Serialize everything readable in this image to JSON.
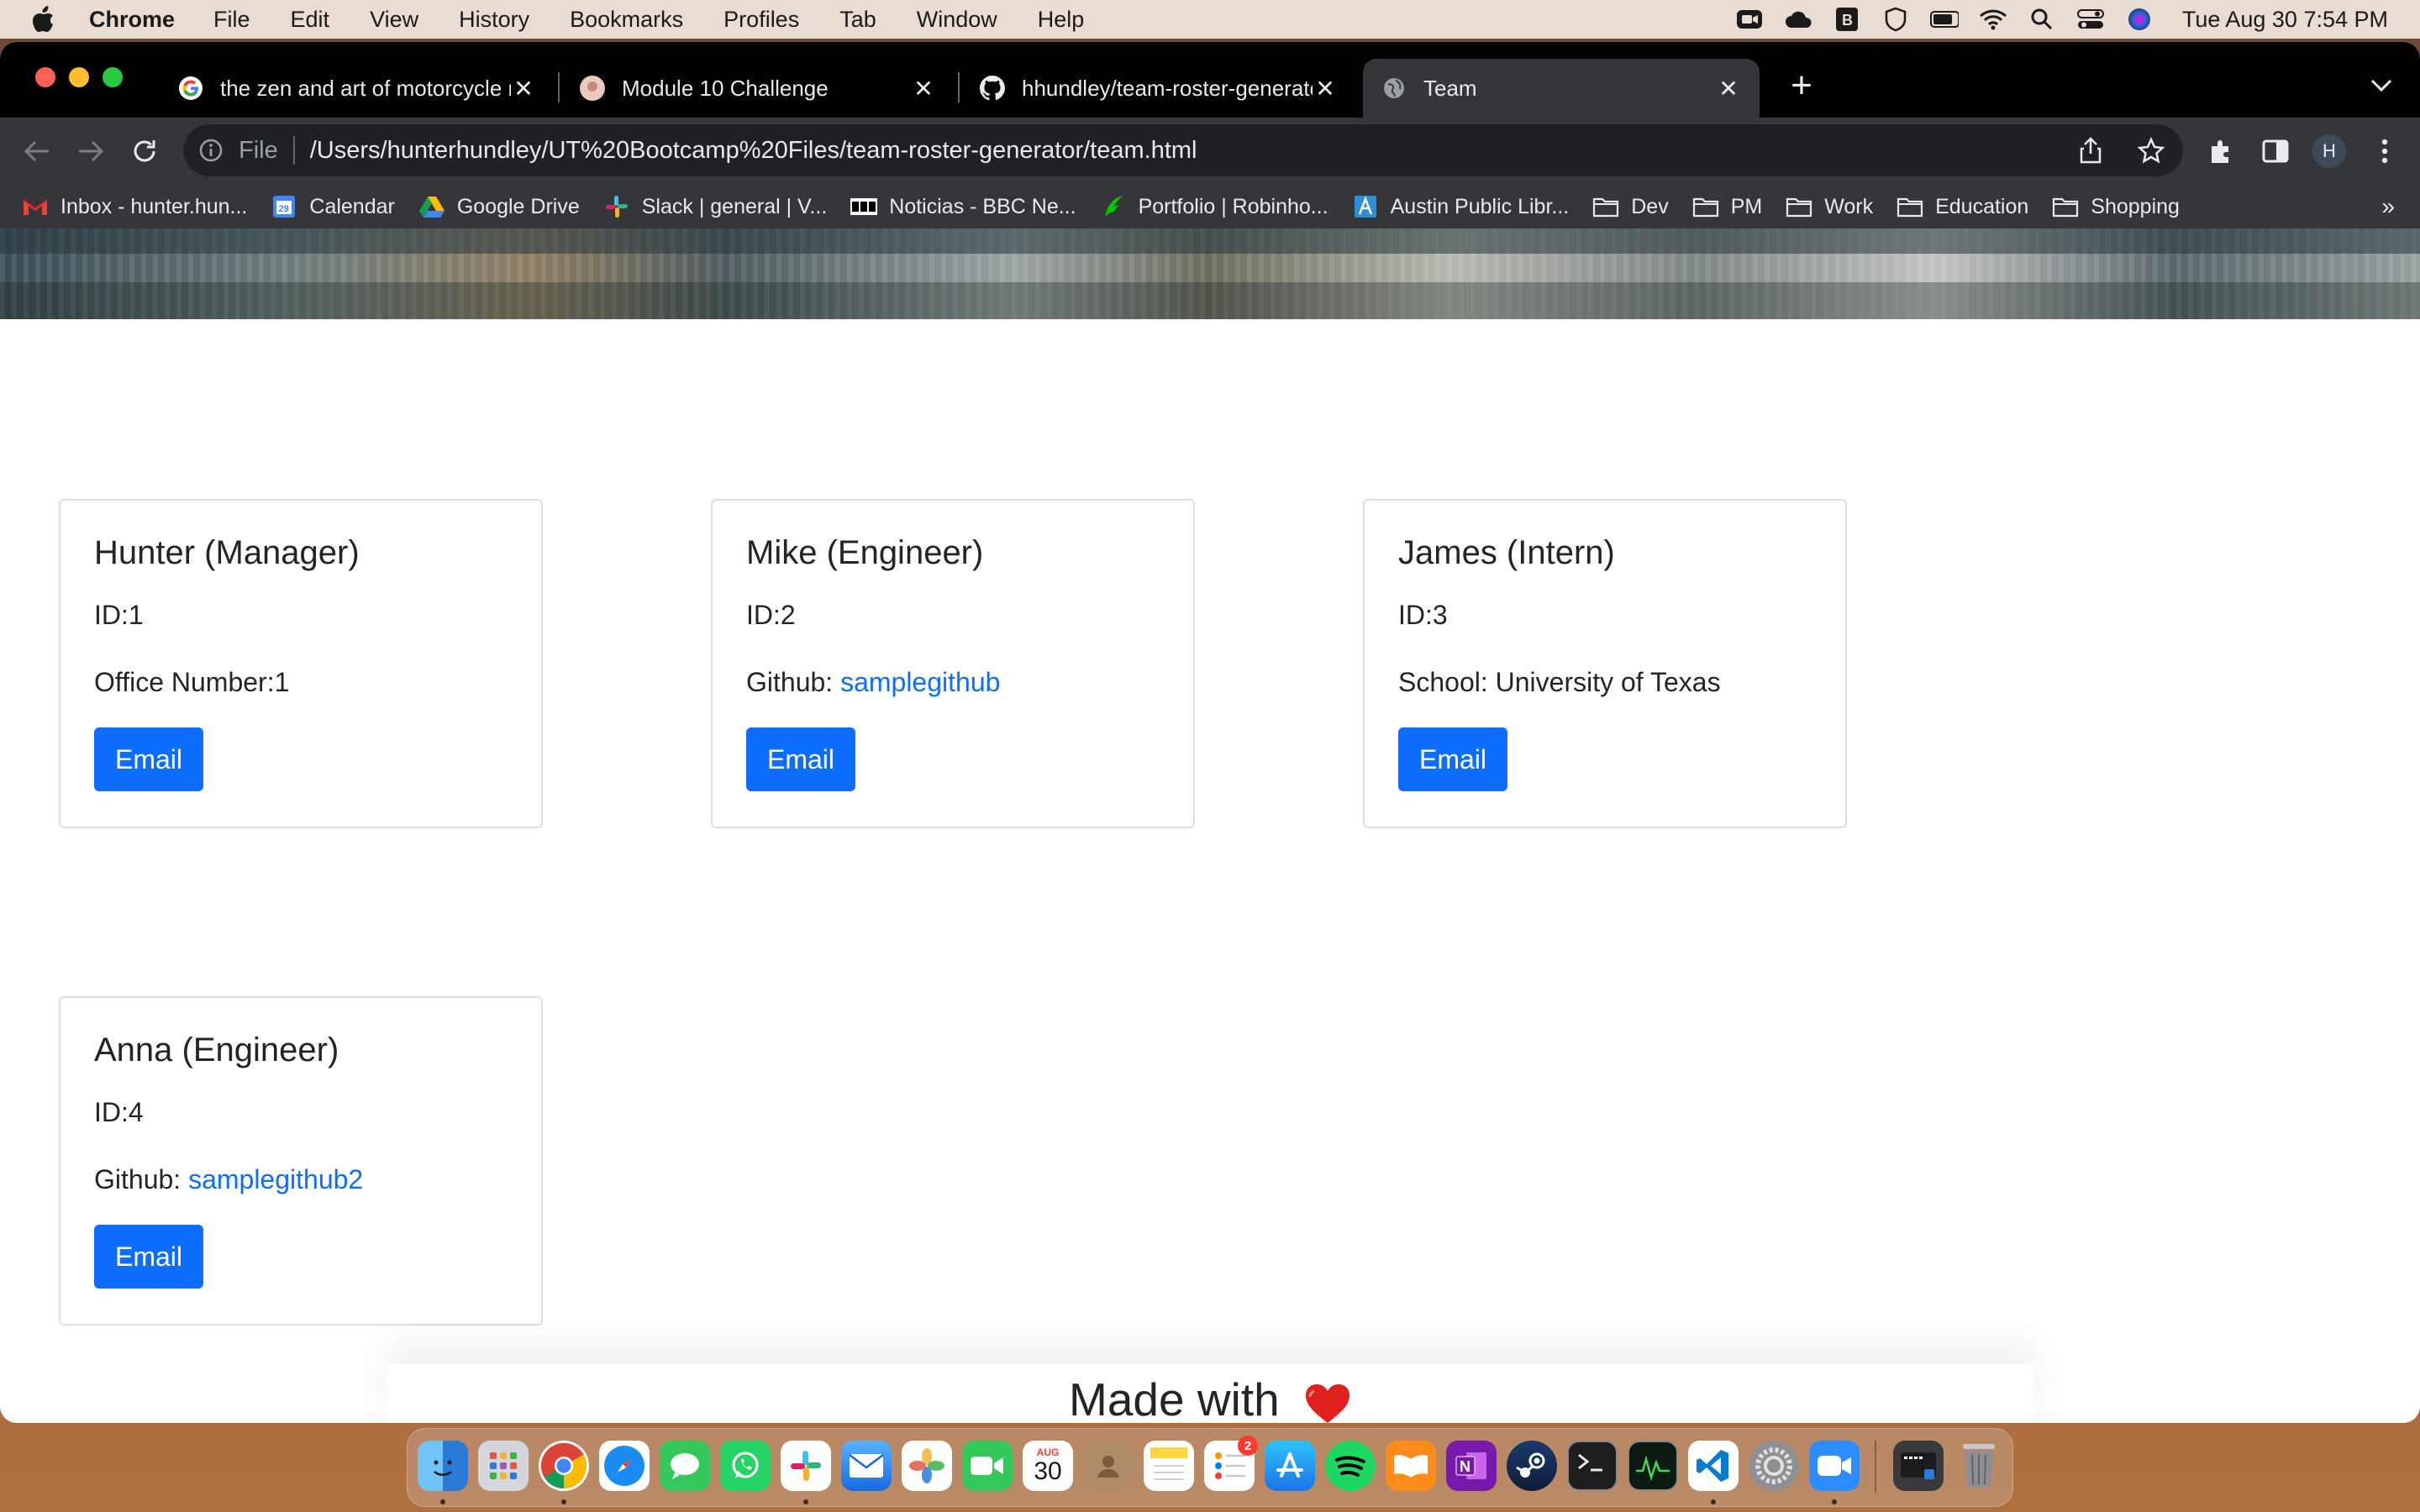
{
  "menubar": {
    "app_name": "Chrome",
    "items": [
      "File",
      "Edit",
      "View",
      "History",
      "Bookmarks",
      "Profiles",
      "Tab",
      "Window",
      "Help"
    ],
    "status_icons": [
      "zoom-icon",
      "cloud-icon",
      "bitwarden-icon",
      "vpn-shield-icon",
      "battery-icon",
      "wifi-icon",
      "spotlight-search-icon",
      "control-center-icon",
      "siri-icon"
    ],
    "clock": "Tue Aug 30  7:54 PM"
  },
  "tabs": [
    {
      "title": "the zen and art of motorcycle m",
      "icon": "google-icon",
      "active": false
    },
    {
      "title": "Module 10 Challenge",
      "icon": "site-favicon-icon",
      "active": false
    },
    {
      "title": "hhundley/team-roster-generato",
      "icon": "github-icon",
      "active": false
    },
    {
      "title": "Team",
      "icon": "globe-icon",
      "active": true
    }
  ],
  "omnibox": {
    "scheme": "File",
    "url": "/Users/hunterhundley/UT%20Bootcamp%20Files/team-roster-generator/team.html"
  },
  "profile": {
    "initial": "H"
  },
  "bookmarks": [
    {
      "label": "Inbox - hunter.hun...",
      "icon": "gmail-icon"
    },
    {
      "label": "Calendar",
      "icon": "calendar-icon"
    },
    {
      "label": "Google Drive",
      "icon": "google-drive-icon"
    },
    {
      "label": "Slack | general | V...",
      "icon": "slack-icon"
    },
    {
      "label": "Noticias - BBC Ne...",
      "icon": "bbc-icon"
    },
    {
      "label": "Portfolio | Robinho...",
      "icon": "robinhood-feather-icon"
    },
    {
      "label": "Austin Public Libr...",
      "icon": "library-icon"
    },
    {
      "label": "Dev",
      "icon": "folder-icon"
    },
    {
      "label": "PM",
      "icon": "folder-icon"
    },
    {
      "label": "Work",
      "icon": "folder-icon"
    },
    {
      "label": "Education",
      "icon": "folder-icon"
    },
    {
      "label": "Shopping",
      "icon": "folder-icon"
    }
  ],
  "bookmarks_more": "»",
  "cards": [
    {
      "title": "Hunter (Manager)",
      "id_text": "ID:1",
      "detail_label": "Office Number:1",
      "detail_link": "",
      "button": "Email"
    },
    {
      "title": "Mike (Engineer)",
      "id_text": "ID:2",
      "detail_label": "Github: ",
      "detail_link": "samplegithub",
      "button": "Email"
    },
    {
      "title": "James (Intern)",
      "id_text": "ID:3",
      "detail_label": "School: University of Texas",
      "detail_link": "",
      "button": "Email"
    },
    {
      "title": "Anna (Engineer)",
      "id_text": "ID:4",
      "detail_label": "Github: ",
      "detail_link": "samplegithub2",
      "button": "Email"
    }
  ],
  "footer": {
    "text": "Made with"
  },
  "dock": {
    "apps": [
      "finder-icon",
      "launchpad-icon",
      "chrome-icon",
      "safari-icon",
      "messages-icon",
      "whatsapp-icon",
      "slack-icon",
      "mail-icon",
      "photos-icon",
      "facetime-icon",
      "calendar-icon",
      "contacts-icon",
      "notes-icon",
      "reminders-icon",
      "app-store-icon",
      "spotify-icon",
      "books-icon",
      "onenote-icon",
      "steam-icon",
      "terminal-icon",
      "activity-monitor-icon",
      "vscode-icon",
      "system-preferences-icon",
      "zoom-icon"
    ],
    "calendar_month": "AUG",
    "calendar_day": "30",
    "reminders_badge": "2",
    "trailing": [
      "downloads-stack-icon",
      "trash-icon"
    ]
  },
  "colors": {
    "primary_button": "#0d6efd",
    "link": "#0d6efd",
    "chrome_dark": "#35363a",
    "heart": "#e0201c"
  }
}
